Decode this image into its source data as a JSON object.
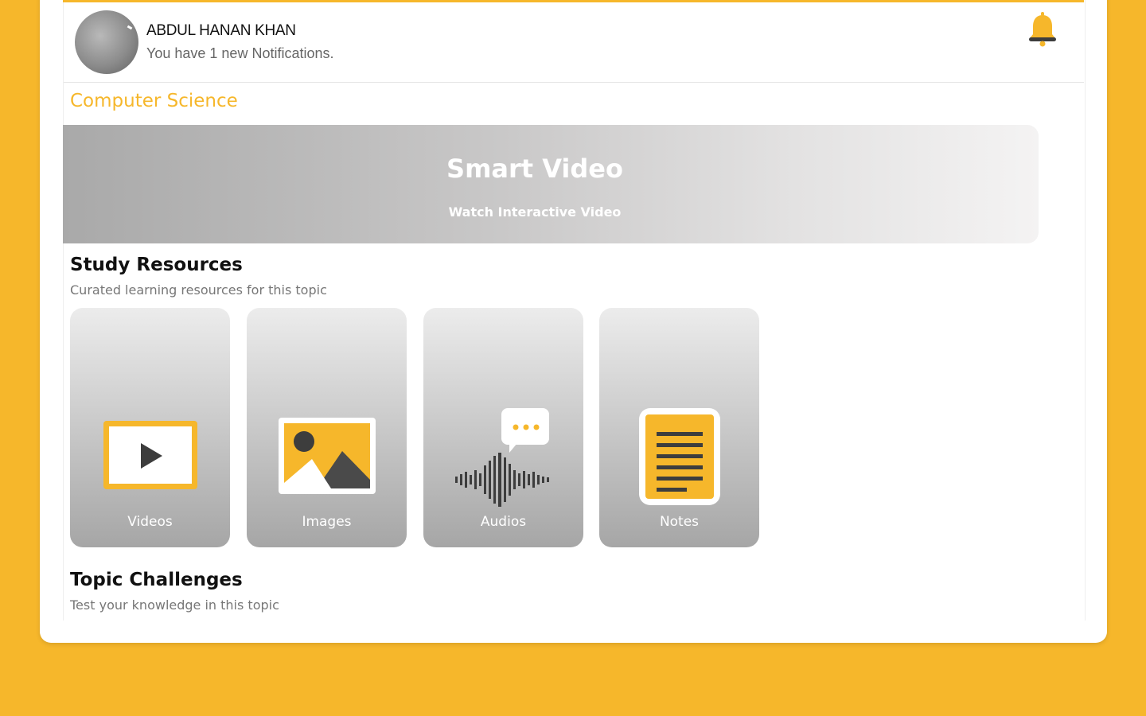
{
  "header": {
    "user_name": "ABDUL HANAN KHAN",
    "notification_text": "You have 1 new Notifications."
  },
  "subject": "Computer Science",
  "banner": {
    "title": "Smart Video",
    "subtitle": "Watch Interactive Video"
  },
  "study_resources": {
    "title": "Study Resources",
    "subtitle": "Curated learning resources for this topic",
    "items": [
      {
        "label": "Videos",
        "icon": "video-play-icon"
      },
      {
        "label": "Images",
        "icon": "image-icon"
      },
      {
        "label": "Audios",
        "icon": "audio-wave-icon"
      },
      {
        "label": "Notes",
        "icon": "notes-icon"
      }
    ]
  },
  "topic_challenges": {
    "title": "Topic Challenges",
    "subtitle": "Test your knowledge in this topic"
  },
  "colors": {
    "accent": "#F6B72B",
    "icon_dark": "#4A4A4A"
  }
}
